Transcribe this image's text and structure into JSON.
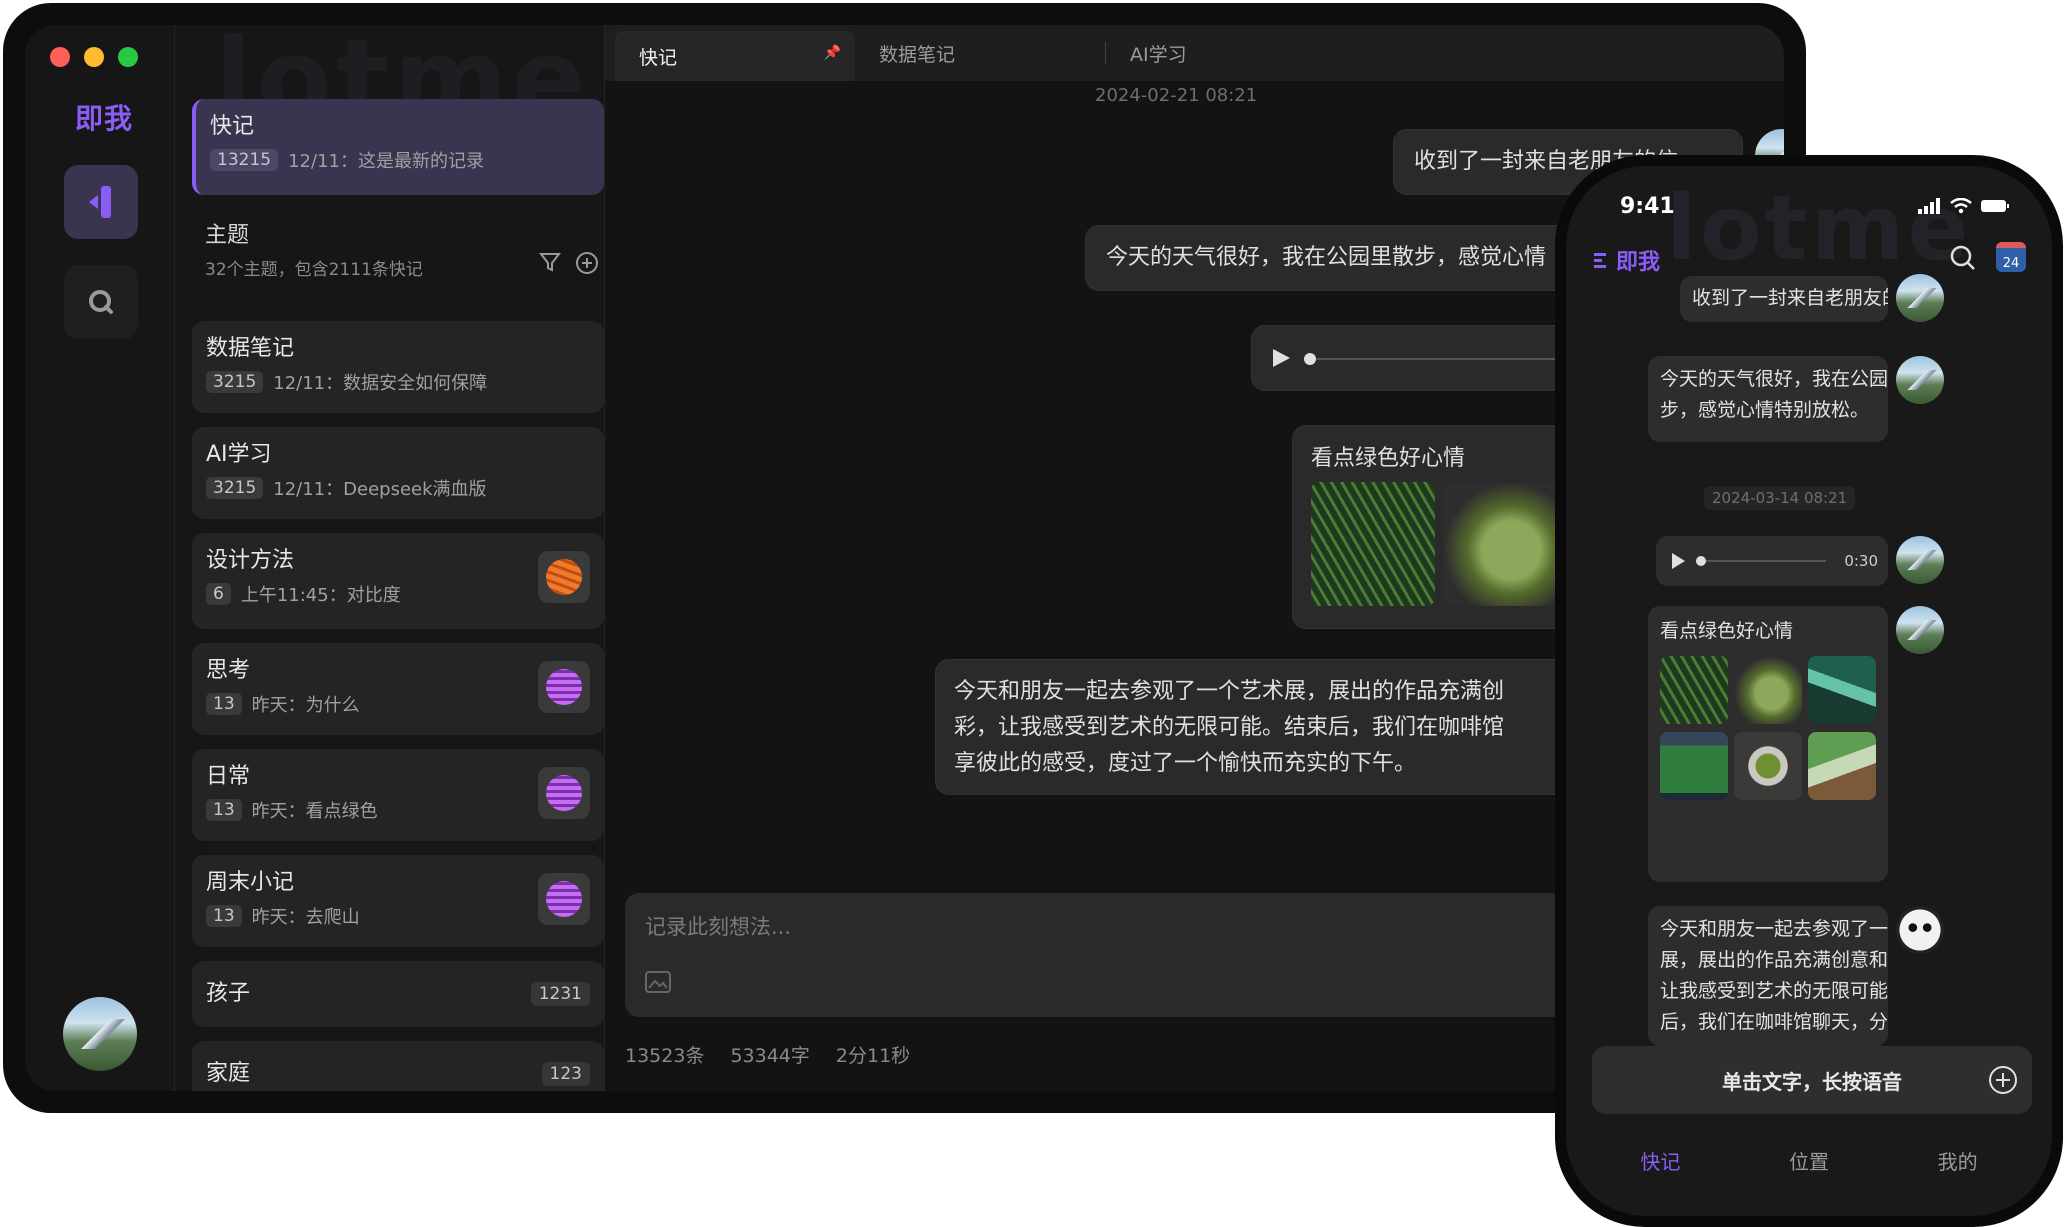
{
  "desktop": {
    "app_name": "即我",
    "watermark": "lotme",
    "sidebar": {
      "quick": {
        "title": "快记",
        "count": "13215",
        "subtitle": "12/11：这是最新的记录"
      },
      "themes": {
        "title": "主题",
        "subtitle": "32个主题，包含2111条快记"
      },
      "items": [
        {
          "title": "数据笔记",
          "count": "3215",
          "subtitle": "12/11：数据安全如何保障"
        },
        {
          "title": "AI学习",
          "count": "3215",
          "subtitle": "12/11：Deepseek满血版"
        },
        {
          "title": "设计方法",
          "count": "6",
          "subtitle": "上午11:45：对比度"
        },
        {
          "title": "思考",
          "count": "13",
          "subtitle": "昨天：为什么"
        },
        {
          "title": "日常",
          "count": "13",
          "subtitle": "昨天：看点绿色"
        },
        {
          "title": "周末小记",
          "count": "13",
          "subtitle": "昨天：去爬山"
        }
      ],
      "simple": [
        {
          "title": "孩子",
          "count": "1231"
        },
        {
          "title": "家庭",
          "count": "123"
        }
      ]
    },
    "tabs": [
      "快记",
      "数据笔记",
      "AI学习"
    ],
    "timestamp": "2024-02-21 08:21",
    "messages": {
      "m1": "收到了一封来自老朋友的信",
      "m2": "今天的天气很好，我在公园里散步，感觉心情",
      "card_title": "看点绿色好心情",
      "m4_l1": "今天和朋友一起去参观了一个艺术展，展出的作品充满创",
      "m4_l2": "彩，让我感受到艺术的无限可能。结束后，我们在咖啡馆",
      "m4_l3": "享彼此的感受，度过了一个愉快而充实的下午。"
    },
    "input_placeholder": "记录此刻想法...",
    "stats": {
      "records": "13523条",
      "chars": "53344字",
      "duration": "2分11秒"
    }
  },
  "phone": {
    "time": "9:41",
    "app_name": "即我",
    "watermark": "lotme",
    "calendar_day": "24",
    "messages": {
      "m1": "收到了一封来自老朋友的信",
      "m2_l1": "今天的天气很好，我在公园里散",
      "m2_l2": "步，感觉心情特别放松。",
      "date": "2024-03-14 08:21",
      "audio_len": "0:30",
      "card_title": "看点绿色好心情",
      "m4_l1": "今天和朋友一起去参观了一个艺术",
      "m4_l2": "展，展出的作品充满创意和色彩，",
      "m4_l3": "让我感受到艺术的无限可能。结束",
      "m4_l4": "后，我们在咖啡馆聊天，分享彼此"
    },
    "input_label": "单击文字，长按语音",
    "nav": [
      "快记",
      "位置",
      "我的"
    ]
  },
  "colors": {
    "accent": "#8b5cf6",
    "bg": "#141414",
    "card": "#242424"
  }
}
